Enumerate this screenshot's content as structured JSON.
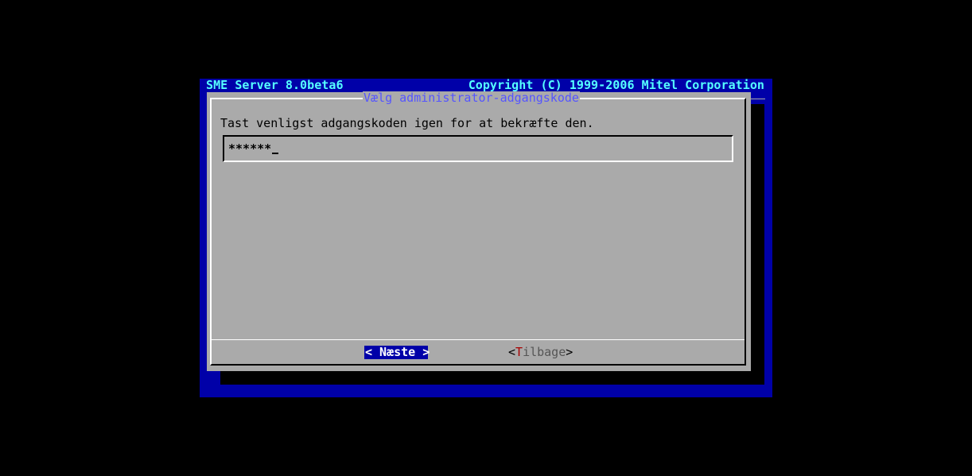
{
  "header": {
    "product": "SME Server 8.0beta6",
    "copyright": "Copyright (C) 1999-2006 Mitel Corporation"
  },
  "dialog": {
    "title": "Vælg administrator-adgangskode",
    "prompt": "Tast venligst adgangskoden igen for at bekræfte den.",
    "password_value": "******",
    "buttons": {
      "next_label": "< Næste >",
      "back_open": "<",
      "back_hotkey": "T",
      "back_rest": "ilbage",
      "back_close": ">"
    }
  },
  "colors": {
    "screen_background": "#0000a8",
    "dialog_background": "#aaaaaa",
    "header_text": "#55ffff",
    "title_text": "#5555ff",
    "active_button": "#0000a8",
    "hotkey": "#a80000"
  }
}
